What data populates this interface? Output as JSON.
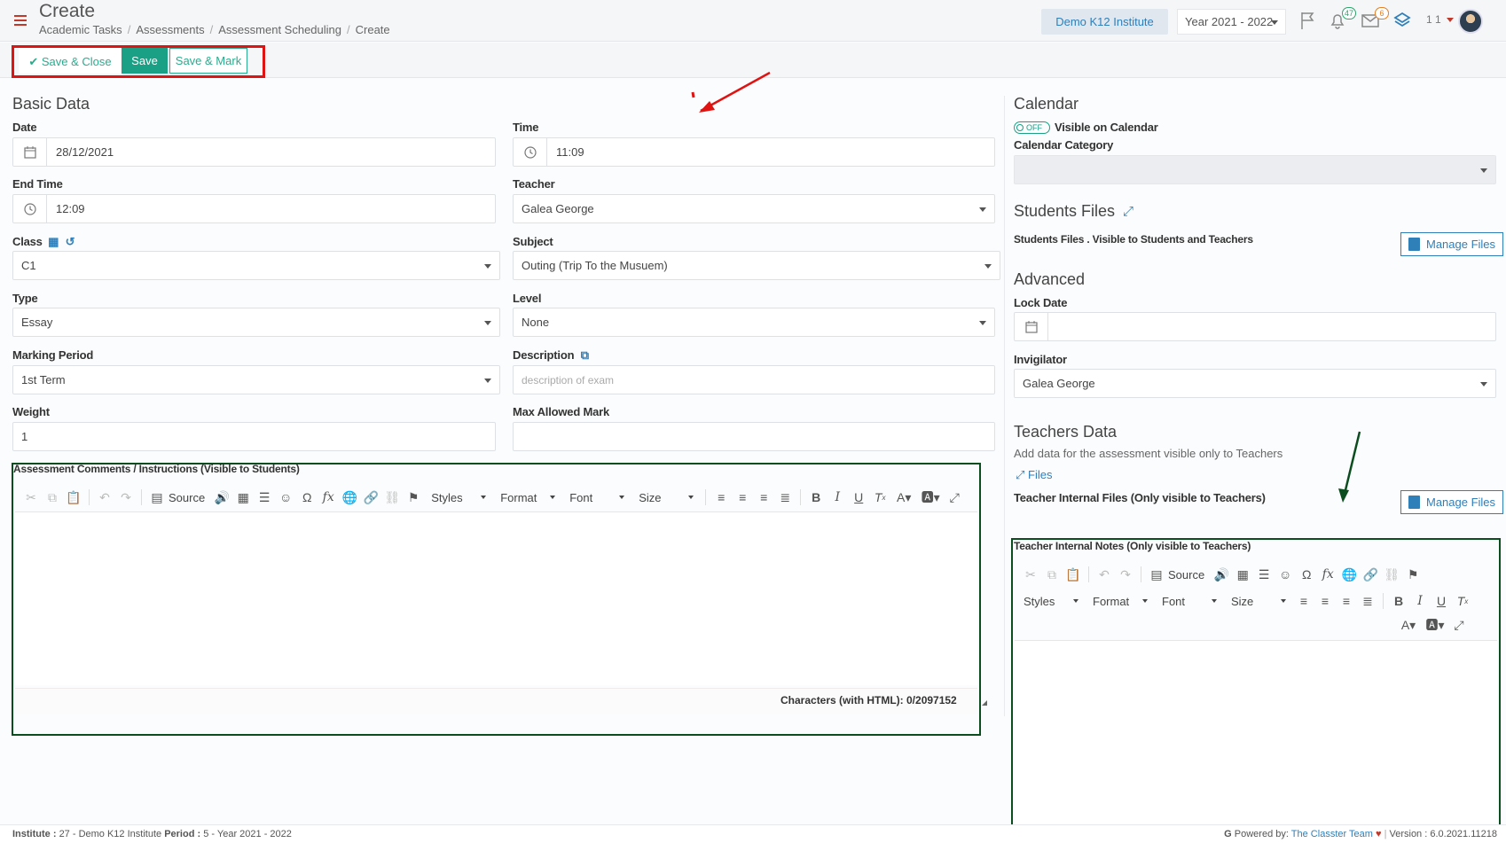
{
  "header": {
    "title": "Create",
    "breadcrumb": [
      "Academic Tasks",
      "Assessments",
      "Assessment Scheduling",
      "Create"
    ],
    "institute": "Demo K12 Institute",
    "year": "Year 2021 - 2022",
    "notifications_badge": "47",
    "messages_badge": "6",
    "user_count": "1 1"
  },
  "actions": {
    "save_close": "Save & Close",
    "save": "Save",
    "save_mark": "Save & Mark"
  },
  "basic": {
    "title": "Basic Data",
    "date_label": "Date",
    "date_value": "28/12/2021",
    "time_label": "Time",
    "time_value": "11:09",
    "end_time_label": "End Time",
    "end_time_value": "12:09",
    "teacher_label": "Teacher",
    "teacher_value": "Galea George",
    "class_label": "Class",
    "class_value": "C1",
    "subject_label": "Subject",
    "subject_value": "Outing (Trip To the Musuem)",
    "type_label": "Type",
    "type_value": "Essay",
    "level_label": "Level",
    "level_value": "None",
    "marking_label": "Marking Period",
    "marking_value": "1st Term",
    "description_label": "Description",
    "description_placeholder": "description of exam",
    "weight_label": "Weight",
    "weight_value": "1",
    "max_mark_label": "Max Allowed Mark",
    "max_mark_value": ""
  },
  "comments_editor": {
    "label": "Assessment Comments / Instructions (Visible to Students)",
    "source": "Source",
    "styles": "Styles",
    "format": "Format",
    "font": "Font",
    "size": "Size",
    "char_count": "Characters (with HTML): 0/2097152"
  },
  "calendar": {
    "title": "Calendar",
    "toggle": "OFF",
    "visible_label": "Visible on Calendar",
    "category_label": "Calendar Category",
    "category_value": ""
  },
  "students_files": {
    "title": "Students Files",
    "description": "Students Files . Visible to Students and Teachers",
    "manage": "Manage Files"
  },
  "advanced": {
    "title": "Advanced",
    "lock_label": "Lock Date",
    "lock_value": "",
    "invigilator_label": "Invigilator",
    "invigilator_value": "Galea George"
  },
  "teachers": {
    "title": "Teachers Data",
    "subtitle": "Add data for the assessment visible only to Teachers",
    "files_link": "Files",
    "internal_files": "Teacher Internal Files (Only visible to Teachers)",
    "manage": "Manage Files",
    "notes_label": "Teacher Internal Notes (Only visible to Teachers)",
    "source": "Source",
    "styles": "Styles",
    "format": "Format",
    "font": "Font",
    "size": "Size"
  },
  "footer": {
    "institute_label": "Institute :",
    "institute_value": "27 - Demo K12 Institute",
    "period_label": "Period :",
    "period_value": "5 - Year 2021 - 2022",
    "powered_prefix": "Powered by:",
    "powered_team": "The Classter Team",
    "version": "Version : 6.0.2021.11218"
  },
  "colors": {
    "accent": "#1aa085",
    "link": "#2f7fb9",
    "highlight_red": "#e01313",
    "highlight_green": "#0b4d1e"
  }
}
